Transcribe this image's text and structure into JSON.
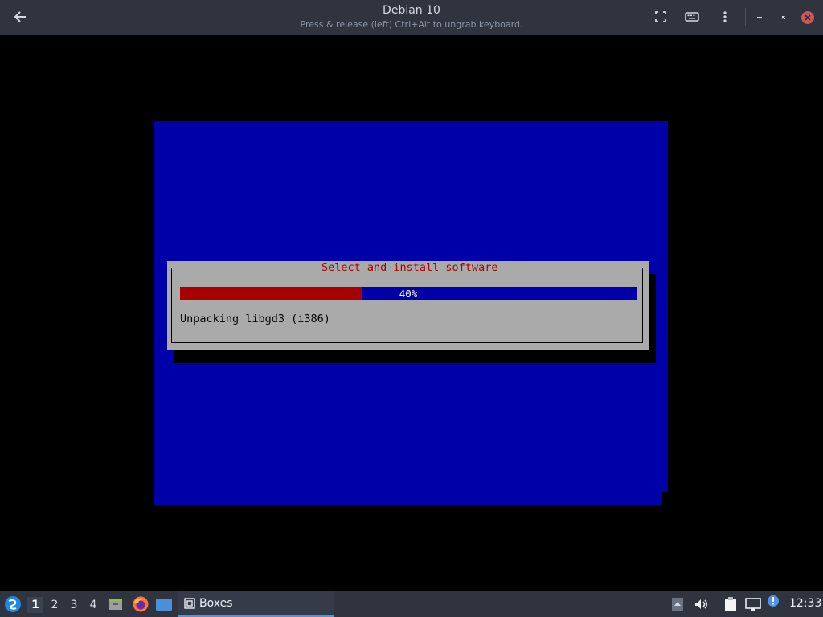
{
  "header": {
    "title": "Debian 10",
    "subtitle": "Press & release (left) Ctrl+Alt to ungrab keyboard.",
    "icons": [
      "back-arrow-icon",
      "fullscreen-icon",
      "keyboard-icon",
      "kebab-menu-icon",
      "minimize-icon",
      "restore-icon",
      "close-icon"
    ]
  },
  "installer": {
    "dialog_title": "Select and install software",
    "progress_label": "40%",
    "progress_value": 0.4,
    "status": "Unpacking libgd3 (i386)",
    "colors": {
      "background": "#0000a8",
      "dialog": "#aaaaaa",
      "title_text": "#a80000",
      "progress_fill": "#a80000",
      "progress_track": "#0000a8"
    }
  },
  "taskbar": {
    "menu_icon": "start-menu-icon",
    "workspaces": [
      "1",
      "2",
      "3",
      "4"
    ],
    "active_workspace": "1",
    "launchers": [
      "file-manager-icon",
      "firefox-icon",
      "desktop-icon"
    ],
    "task": {
      "label": "Boxes",
      "icon": "boxes-app-icon"
    },
    "tray_icons": [
      "tray-expand-icon",
      "volume-icon",
      "clipboard-icon",
      "network-icon",
      "update-notifier-icon"
    ],
    "clock": "12:33"
  }
}
